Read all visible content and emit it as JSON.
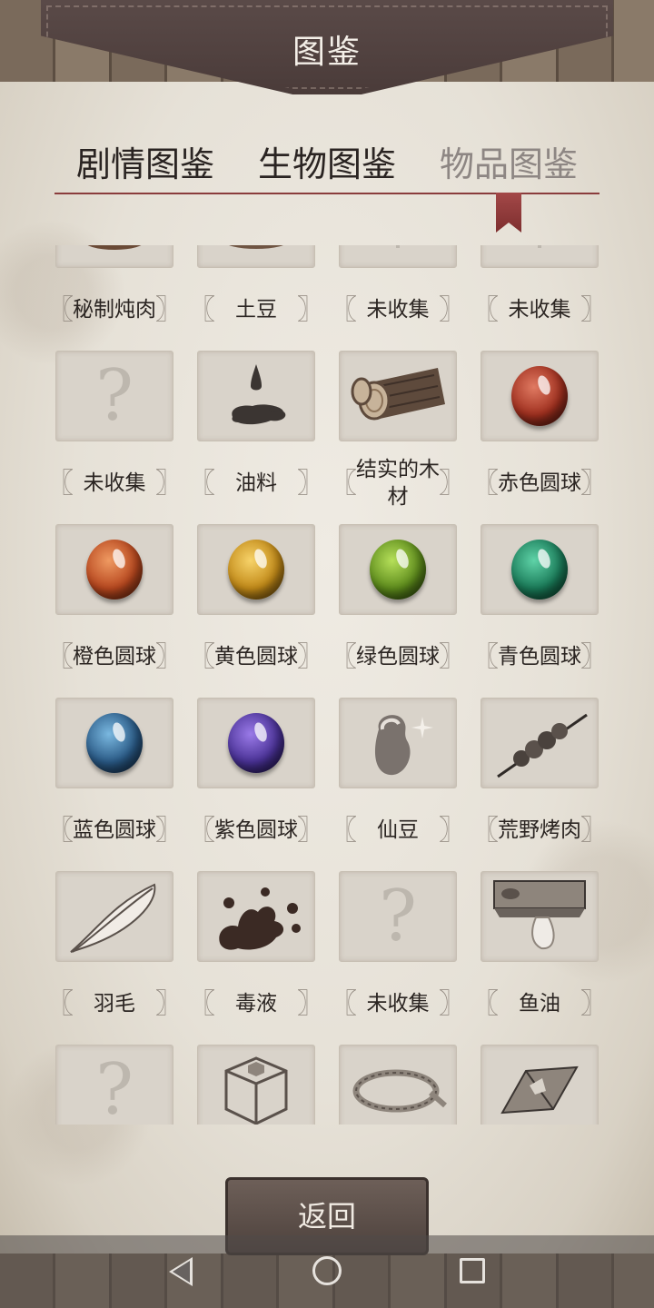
{
  "header": {
    "title": "图鉴"
  },
  "tabs": [
    {
      "label": "剧情图鉴",
      "active": false
    },
    {
      "label": "生物图鉴",
      "active": false
    },
    {
      "label": "物品图鉴",
      "active": true
    }
  ],
  "items": [
    {
      "label": "秘制炖肉",
      "icon": "stew-icon"
    },
    {
      "label": "土豆",
      "icon": "potato-icon"
    },
    {
      "label": "未收集",
      "icon": "unknown-icon"
    },
    {
      "label": "未收集",
      "icon": "unknown-icon"
    },
    {
      "label": "未收集",
      "icon": "question-mark-icon"
    },
    {
      "label": "油料",
      "icon": "oil-drop-icon"
    },
    {
      "label": "结实的木材",
      "icon": "log-icon"
    },
    {
      "label": "赤色圆球",
      "icon": "red-orb-icon",
      "color": "#b23a2a"
    },
    {
      "label": "橙色圆球",
      "icon": "orange-orb-icon",
      "color": "#c4552a"
    },
    {
      "label": "黄色圆球",
      "icon": "yellow-orb-icon",
      "color": "#d29a22"
    },
    {
      "label": "绿色圆球",
      "icon": "green-orb-icon",
      "color": "#6e9a22"
    },
    {
      "label": "青色圆球",
      "icon": "cyan-orb-icon",
      "color": "#1f8060"
    },
    {
      "label": "蓝色圆球",
      "icon": "blue-orb-icon",
      "color": "#2f5d8a"
    },
    {
      "label": "紫色圆球",
      "icon": "purple-orb-icon",
      "color": "#5c3d9a"
    },
    {
      "label": "仙豆",
      "icon": "magic-bean-icon"
    },
    {
      "label": "荒野烤肉",
      "icon": "skewer-icon"
    },
    {
      "label": "羽毛",
      "icon": "feather-icon"
    },
    {
      "label": "毒液",
      "icon": "venom-splat-icon"
    },
    {
      "label": "未收集",
      "icon": "question-mark-icon"
    },
    {
      "label": "鱼油",
      "icon": "fish-oil-icon"
    },
    {
      "label": "",
      "icon": "question-mark-icon"
    },
    {
      "label": "",
      "icon": "stone-box-icon"
    },
    {
      "label": "",
      "icon": "rope-icon"
    },
    {
      "label": "",
      "icon": "metal-shard-icon"
    }
  ],
  "footer": {
    "back_label": "返回"
  }
}
